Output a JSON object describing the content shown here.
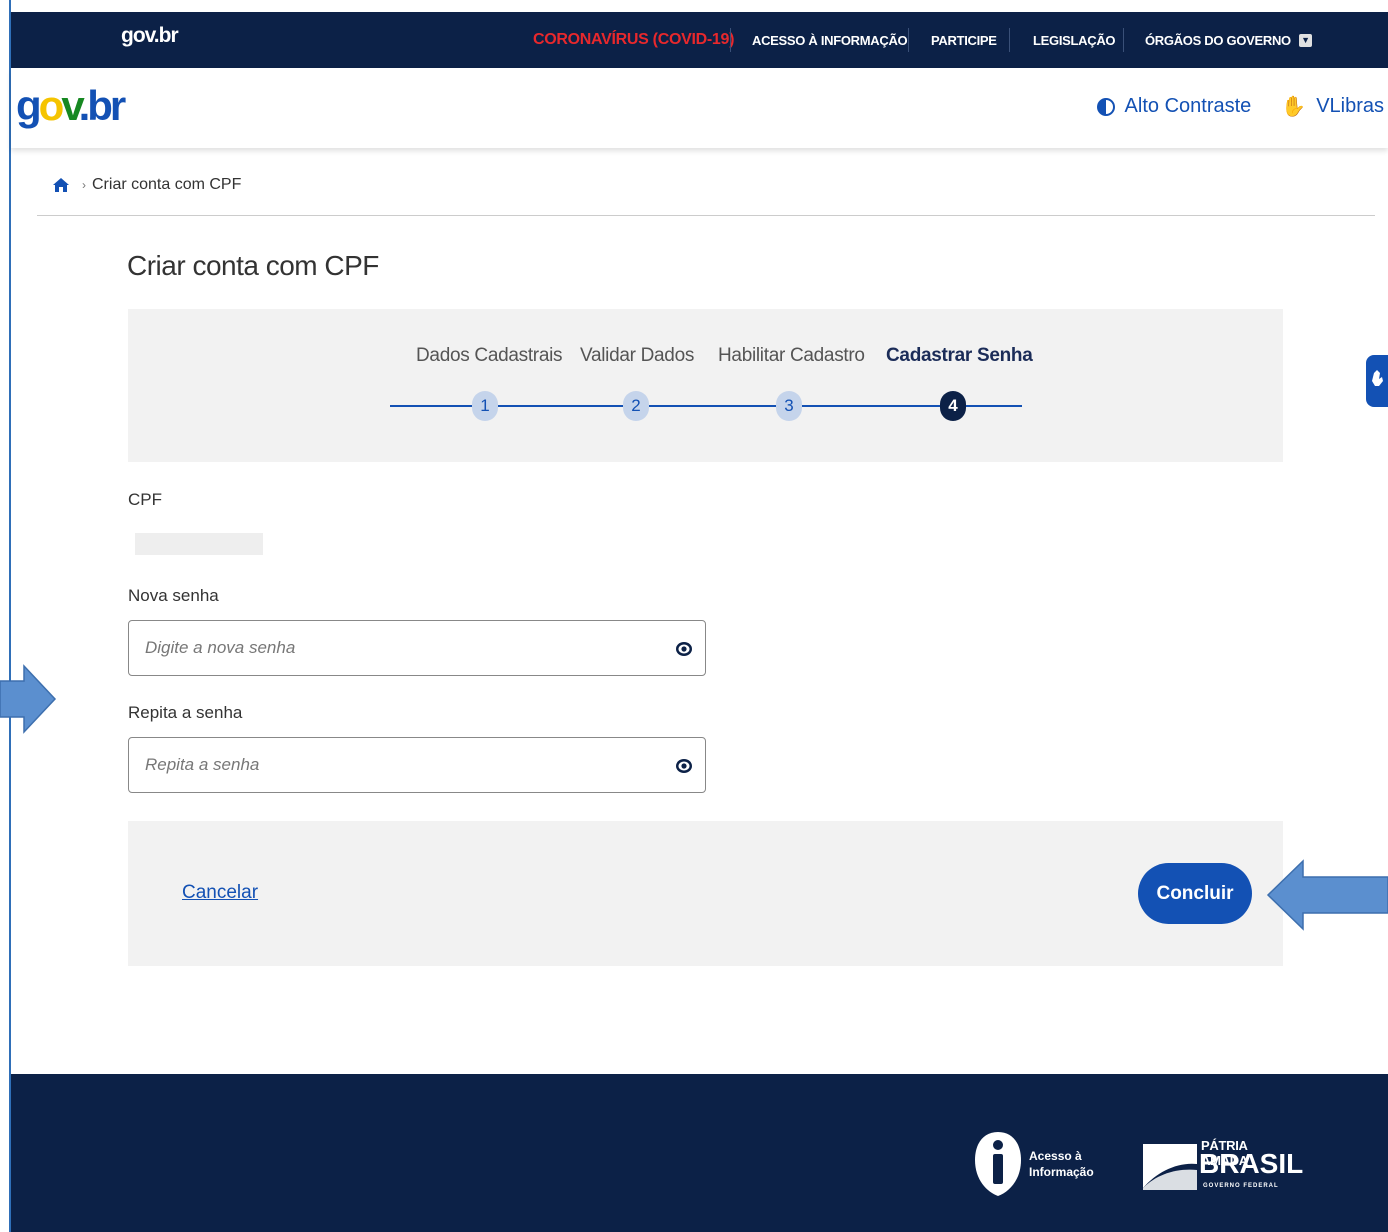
{
  "gov_bar": {
    "logo": "gov.br",
    "covid": "CORONAVÍRUS (COVID-19)",
    "nav": [
      "ACESSO À INFORMAÇÃO",
      "PARTICIPE",
      "LEGISLAÇÃO",
      "ÓRGÃOS DO GOVERNO"
    ]
  },
  "header": {
    "brand": {
      "g": "g",
      "o": "o",
      "v": "v",
      "br": ".br"
    },
    "contrast": "Alto Contraste",
    "libras": "VLibras"
  },
  "breadcrumb": {
    "current": "Criar conta com CPF"
  },
  "page": {
    "title": "Criar conta com CPF"
  },
  "stepper": {
    "steps": [
      {
        "label": "Dados Cadastrais",
        "number": "1"
      },
      {
        "label": "Validar Dados",
        "number": "2"
      },
      {
        "label": "Habilitar Cadastro",
        "number": "3"
      },
      {
        "label": "Cadastrar Senha",
        "number": "4"
      }
    ],
    "active_step": 4
  },
  "form": {
    "cpf_label": "CPF",
    "new_password_label": "Nova senha",
    "new_password_placeholder": "Digite a nova senha",
    "repeat_password_label": "Repita a senha",
    "repeat_password_placeholder": "Repita a senha"
  },
  "actions": {
    "cancel": "Cancelar",
    "submit": "Concluir"
  },
  "footer": {
    "access_info": [
      "Acesso à",
      "Informação"
    ],
    "brasil": {
      "top": "PÁTRIA AMADA",
      "main": "BRASIL",
      "sub": "GOVERNO FEDERAL"
    }
  },
  "colors": {
    "primary": "#1351b4",
    "navy": "#0c2147",
    "covid": "#e8282c",
    "arrow": "#5b8fcf"
  },
  "icons": [
    "home-icon",
    "chevron-down-icon",
    "contrast-icon",
    "hand-icon",
    "eye-icon",
    "info-icon",
    "arrow-right-icon",
    "arrow-left-icon"
  ]
}
